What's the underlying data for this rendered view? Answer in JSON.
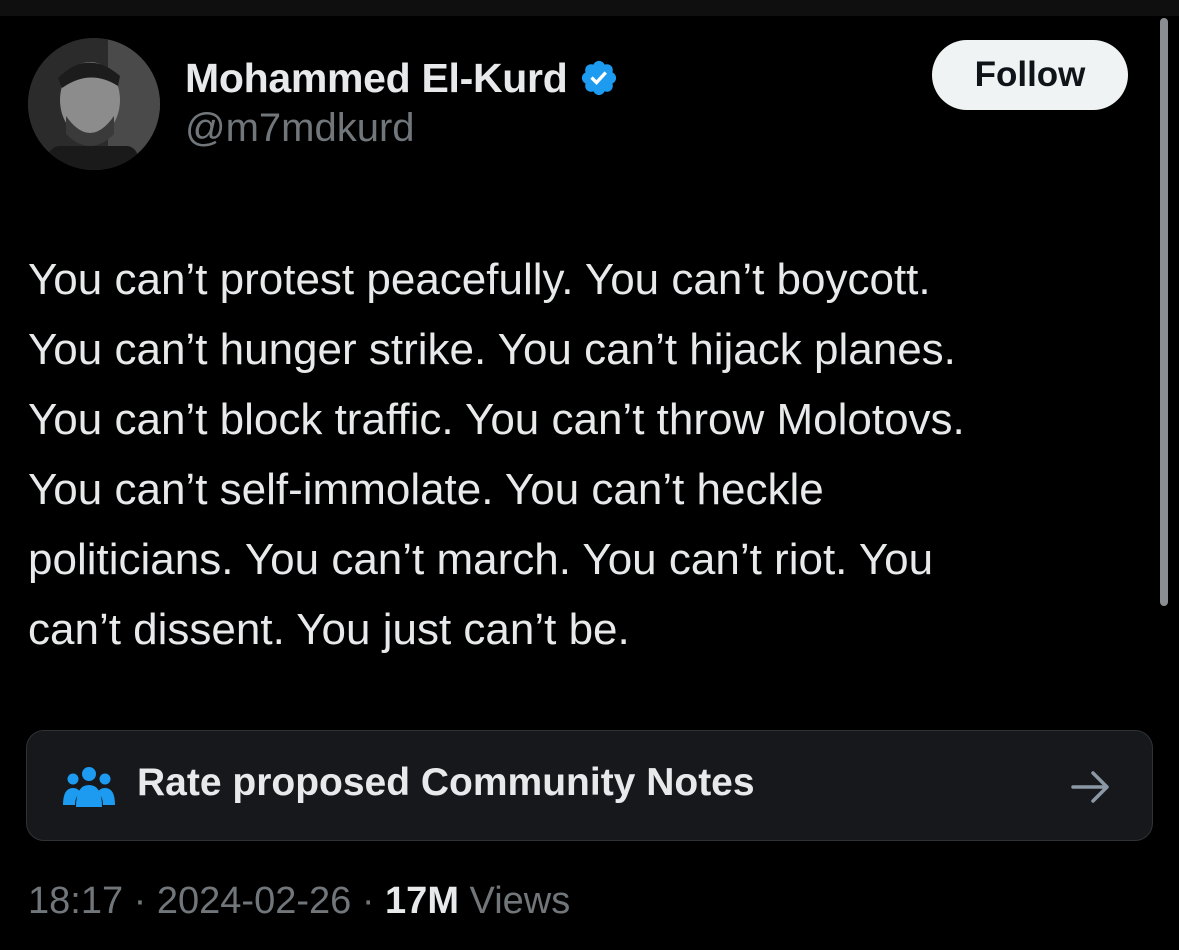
{
  "author": {
    "display_name": "Mohammed El-Kurd",
    "handle": "@m7mdkurd",
    "verified_color": "#1d9bf0"
  },
  "follow_button": {
    "label": "Follow"
  },
  "tweet": {
    "lines": [
      "You can’t protest peacefully. You can’t boycott.",
      "You can’t hunger strike. You can’t hijack planes.",
      "You can’t block traffic. You can’t throw Molotovs.",
      "You can’t self-immolate. You can’t heckle",
      "politicians. You can’t march. You can’t riot. You",
      "can’t dissent. You just can’t be."
    ]
  },
  "community_notes": {
    "label": "Rate proposed Community Notes",
    "icon": "people-icon",
    "arrow_icon": "arrow-right-icon"
  },
  "meta": {
    "time": "18:17",
    "separator": " · ",
    "date": "2024-02-26",
    "views_count": "17M",
    "views_label": "Views"
  },
  "colors": {
    "background": "#000000",
    "text": "#e7e9ea",
    "secondary": "#71767b",
    "accent": "#1d9bf0"
  }
}
